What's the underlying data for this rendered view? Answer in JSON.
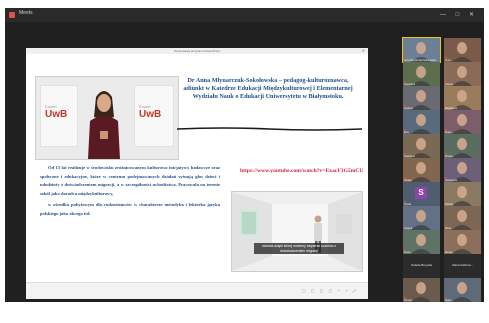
{
  "app": {
    "name": "Meets",
    "window_controls": "— □ ✕"
  },
  "powerpoint": {
    "title": "Prezentacja programu PowerPoint",
    "photo": {
      "brand_left": "UwB",
      "brand_right": "UwB",
      "brand_caption": "Expert"
    },
    "slide_title": "Dr Anna Młynarczuk-Sokołowska – pedagog-kulturoznawca, adiunkt w Katedrze Edukacji Międzykulturowej i Elementarnej Wydziału Nauk o Edukacji Uniwersytetu w Białymstoku.",
    "paragraphs": [
      "Od 15 lat realizuje w środowisku zróżnicowanym kulturowo inicjatywy badawcze oraz społeczne i edukacyjne, które w centrum podejmowanych działań sytuują głos dzieci i młodzieży z doświadczeniem migracji, a w szczególności uchodźstwa. Pracowała na terenie szkół jako doradca międzykulturowy,",
      "w ośrodku pobytowym dla cudzoziemców w charakterze metodyka i lektorka języka polskiego jako obcego itd."
    ],
    "youtube_link": "https://www.youtube.com/watch?v=ExacF3G5mCU",
    "video_caption": "metoda dzięki której możemy wspierać uczniów z doświadczeniem migracji",
    "status_icons": "▢ ▢ ▢ ▢ ─ + ⤢"
  },
  "participants": [
    {
      "name": "Anna Młynarczuk-Sokołowska",
      "active": true,
      "bg": "#6b7f95"
    },
    {
      "name": "Anna",
      "bg": "#7a5a48"
    },
    {
      "name": "Agnieszka",
      "bg": "#5d6e4f"
    },
    {
      "name": "Joanna",
      "bg": "#8a6b58"
    },
    {
      "name": "Karolina",
      "bg": "#6a6a72"
    },
    {
      "name": "Magdalena",
      "bg": "#9a7b5b"
    },
    {
      "name": "Ewa",
      "bg": "#586a7c"
    },
    {
      "name": "Beata",
      "bg": "#7b5e6a"
    },
    {
      "name": "Katarzyna",
      "bg": "#7a6a55"
    },
    {
      "name": "Monika",
      "bg": "#5a6c60"
    },
    {
      "name": "Natalia",
      "bg": "#826650"
    },
    {
      "name": "Aleksandra",
      "bg": "#6e5f78"
    },
    {
      "name": "Sylwia",
      "bg": "#4f5d6e",
      "initial": "S"
    },
    {
      "name": "Paulina",
      "bg": "#8a7a62"
    },
    {
      "name": "Justyna",
      "bg": "#637085"
    },
    {
      "name": "Marta",
      "bg": "#7d6654"
    },
    {
      "name": "Iwona",
      "bg": "#5e7266"
    },
    {
      "name": "Dorota",
      "bg": "#8b6f5c"
    },
    {
      "name": "Izabela Borycka",
      "bg": "#2b2b2b",
      "name_only": true
    },
    {
      "name": "Ulana Kalinow...",
      "bg": "#2b2b2b",
      "name_only": true
    },
    {
      "name": "Renata",
      "bg": "#6b5a4e"
    },
    {
      "name": "Agata",
      "bg": "#5f6a78"
    }
  ]
}
